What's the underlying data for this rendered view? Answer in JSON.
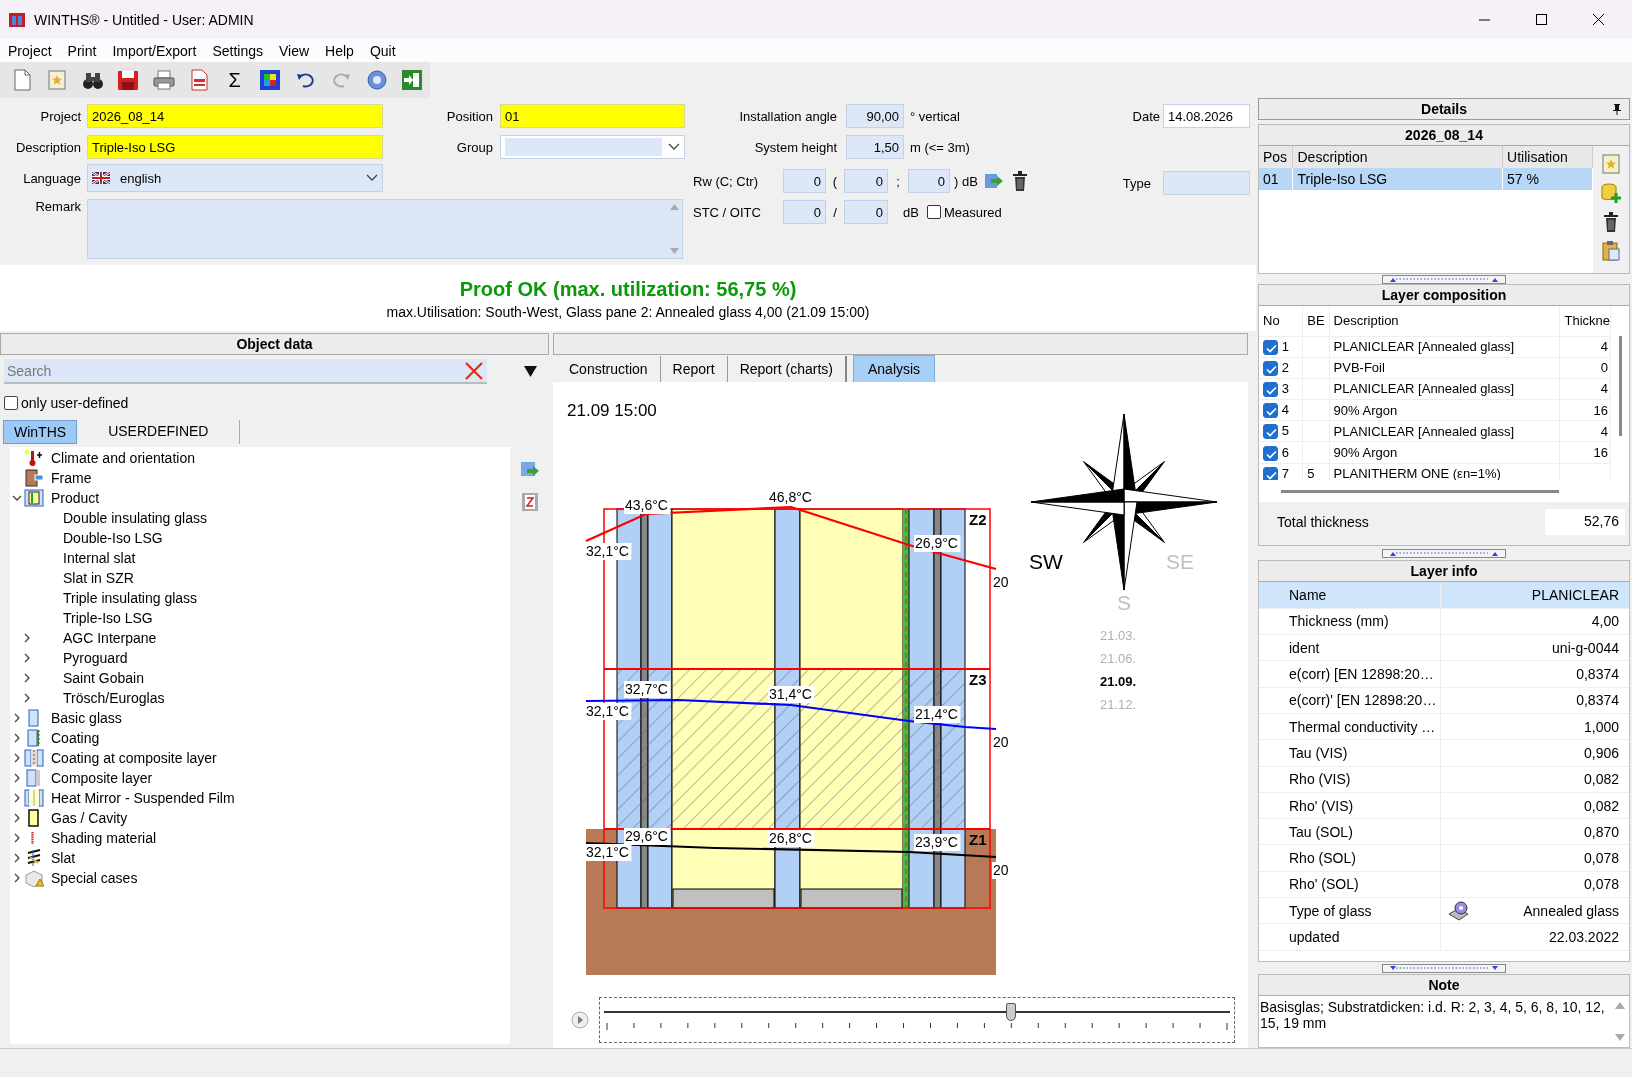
{
  "window": {
    "title": "WINTHS® - Untitled - User: ADMIN"
  },
  "menu": [
    "Project",
    "Print",
    "Import/Export",
    "Settings",
    "View",
    "Help",
    "Quit"
  ],
  "toolbar": {
    "sum_symbol": "Σ"
  },
  "form": {
    "project": {
      "label": "Project",
      "value": "2026_08_14"
    },
    "description": {
      "label": "Description",
      "value": "Triple-Iso LSG"
    },
    "language": {
      "label": "Language",
      "value": "english"
    },
    "remark": {
      "label": "Remark"
    },
    "position": {
      "label": "Position",
      "value": "01"
    },
    "group": {
      "label": "Group"
    },
    "installation_angle": {
      "label": "Installation angle",
      "value": "90,00",
      "unit": "° vertical"
    },
    "system_height": {
      "label": "System height",
      "value": "1,50",
      "unit": "m (<= 3m)"
    },
    "rw": {
      "label": "Rw (C; Ctr)",
      "values": [
        "0",
        "0",
        "0"
      ],
      "separators": [
        "(",
        ";",
        ") dB"
      ]
    },
    "stc": {
      "label": "STC / OITC",
      "values": [
        "0",
        "0"
      ],
      "separators": [
        "/",
        "dB"
      ]
    },
    "measured": {
      "label": "Measured",
      "checked": false
    },
    "date": {
      "label": "Date",
      "value": "14.08.2026"
    },
    "type": {
      "label": "Type"
    }
  },
  "proof": {
    "title": "Proof OK (max. utilization: 56,75 %)",
    "detail": "max.Utilisation: South-West, Glass pane 2: Annealed glass 4,00 (21.09 15:00)"
  },
  "object_data": {
    "title": "Object data",
    "search": {
      "placeholder": "Search"
    },
    "only_user_defined": {
      "label": "only user-defined",
      "checked": false
    },
    "tabs": [
      {
        "label": "WinTHS",
        "selected": true
      },
      {
        "label": "USERDEFINED",
        "selected": false
      }
    ],
    "tree": [
      {
        "label": "Climate and orientation"
      },
      {
        "label": "Frame"
      },
      {
        "label": "Product",
        "expanded": true,
        "children": [
          {
            "label": "Double insulating glass"
          },
          {
            "label": "Double-Iso LSG"
          },
          {
            "label": "Internal slat"
          },
          {
            "label": "Slat in SZR"
          },
          {
            "label": "Triple insulating glass"
          },
          {
            "label": "Triple-Iso LSG"
          },
          {
            "label": "AGC Interpane",
            "expanded": false
          },
          {
            "label": "Pyroguard",
            "expanded": false
          },
          {
            "label": "Saint Gobain",
            "expanded": false
          },
          {
            "label": "Trösch/Euroglas",
            "expanded": false
          }
        ]
      },
      {
        "label": "Basic glass",
        "expanded": false
      },
      {
        "label": "Coating",
        "expanded": false
      },
      {
        "label": "Coating at composite layer",
        "expanded": false
      },
      {
        "label": "Composite layer",
        "expanded": false
      },
      {
        "label": "Heat Mirror - Suspended Film",
        "expanded": false
      },
      {
        "label": "Gas / Cavity",
        "expanded": false
      },
      {
        "label": "Shading material",
        "expanded": false
      },
      {
        "label": "Slat",
        "expanded": false
      },
      {
        "label": "Special cases",
        "expanded": false
      }
    ]
  },
  "center_tabs": [
    {
      "label": "Construction",
      "selected": false
    },
    {
      "label": "Report",
      "selected": false
    },
    {
      "label": "Report (charts)",
      "selected": false
    },
    {
      "label": "Analysis",
      "selected": true
    }
  ],
  "analysis": {
    "timestamp": "21.09 15:00",
    "zones": [
      {
        "label": "Z2",
        "color": "#ff0000",
        "hatched": false,
        "temps": [
          "43,6°C",
          "46,8°C",
          "32,1°C",
          "26,9°C",
          "20"
        ]
      },
      {
        "label": "Z3",
        "color": "#0000ff",
        "hatched": true,
        "temps": [
          "32,7°C",
          "31,4°C",
          "32,1°C",
          "21,4°C",
          "20"
        ]
      },
      {
        "label": "Z1",
        "color": "#000000",
        "hatched": false,
        "temps": [
          "29,6°C",
          "26,8°C",
          "32,1°C",
          "23,9°C",
          "20"
        ]
      }
    ],
    "directions": [
      {
        "label": "SW",
        "active": true
      },
      {
        "label": "SE",
        "active": false
      },
      {
        "label": "S",
        "active": false
      }
    ],
    "dates": [
      {
        "label": "21.03.",
        "selected": false
      },
      {
        "label": "21.06.",
        "selected": false
      },
      {
        "label": "21.09.",
        "selected": true
      },
      {
        "label": "21.12.",
        "selected": false
      }
    ],
    "slider": {
      "level": 0.65
    }
  },
  "details": {
    "title": "Details",
    "project": "2026_08_14",
    "columns": [
      "Pos",
      "Description",
      "Utilisation"
    ],
    "rows": [
      {
        "cells": [
          "01",
          "Triple-Iso LSG",
          "57 %"
        ],
        "selected": true
      }
    ]
  },
  "layer_composition": {
    "title": "Layer composition",
    "columns": [
      "No",
      "BE",
      "Description",
      "Thickne"
    ],
    "rows": [
      {
        "checked": true,
        "no": "1",
        "description": "PLANICLEAR [Annealed glass]",
        "thickness": "4"
      },
      {
        "checked": true,
        "no": "2",
        "description": "PVB-Foil",
        "thickness": "0"
      },
      {
        "checked": true,
        "no": "3",
        "description": "PLANICLEAR [Annealed glass]",
        "thickness": "4"
      },
      {
        "checked": true,
        "no": "4",
        "description": "90% Argon",
        "thickness": "16"
      },
      {
        "checked": true,
        "no": "5",
        "description": "PLANICLEAR [Annealed glass]",
        "thickness": "4"
      },
      {
        "checked": true,
        "no": "6",
        "description": "90% Argon",
        "thickness": "16"
      },
      {
        "checked": true,
        "no": "7",
        "be": "5",
        "description": "PLANITHERM ONE (εn=1%)"
      }
    ],
    "total": {
      "label": "Total thickness",
      "value": "52,76"
    }
  },
  "layer_info": {
    "title": "Layer info",
    "rows": [
      {
        "kind": "text",
        "name": "Name",
        "value": "PLANICLEAR",
        "selected": true
      },
      {
        "kind": "text",
        "name": "Thickness (mm)",
        "value": "4,00",
        "selected": false
      },
      {
        "kind": "text",
        "name": "ident",
        "value": "uni-g-0044",
        "selected": false
      },
      {
        "kind": "text",
        "name": "e(corr) [EN 12898:20…",
        "value": "0,8374",
        "selected": false
      },
      {
        "kind": "text",
        "name": "e(corr)' [EN 12898:20…",
        "value": "0,8374",
        "selected": false
      },
      {
        "kind": "text",
        "name": "Thermal conductivity …",
        "value": "1,000",
        "selected": false
      },
      {
        "kind": "text",
        "name": "Tau (VIS)",
        "value": "0,906",
        "selected": false
      },
      {
        "kind": "text",
        "name": "Rho (VIS)",
        "value": "0,082",
        "selected": false
      },
      {
        "kind": "text",
        "name": "Rho' (VIS)",
        "value": "0,082",
        "selected": false
      },
      {
        "kind": "text",
        "name": "Tau (SOL)",
        "value": "0,870",
        "selected": false
      },
      {
        "kind": "text",
        "name": "Rho (SOL)",
        "value": "0,078",
        "selected": false
      },
      {
        "kind": "text",
        "name": "Rho' (SOL)",
        "value": "0,078",
        "selected": false
      },
      {
        "kind": "glass-type",
        "name": "Type of glass",
        "value": "Annealed glass",
        "selected": false
      },
      {
        "kind": "text",
        "name": "updated",
        "value": "22.03.2022",
        "selected": false
      }
    ]
  },
  "note": {
    "title": "Note",
    "text": "Basisglas; Substratdicken: i.d. R: 2, 3, 4, 5, 6, 8, 10, 12, 15, 19 mm"
  }
}
